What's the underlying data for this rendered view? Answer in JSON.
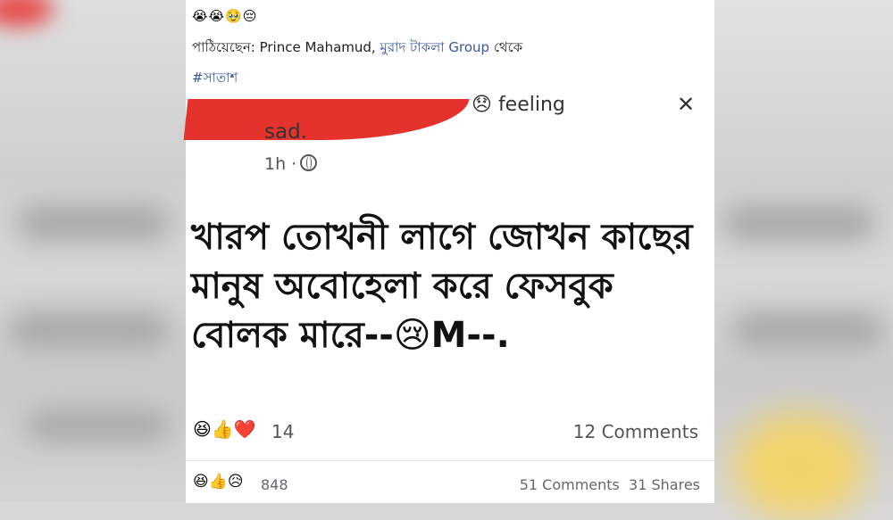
{
  "header": {
    "emojis": "😭😭🥹😔",
    "sent_prefix": "পাঠিয়েছেন: Prince Mahamud, ",
    "sent_group": "মুরাদ টাকলা Group",
    "sent_suffix": " থেকে",
    "hashtag": "#সাতাশ"
  },
  "screenshot": {
    "feeling_text": "feeling",
    "feeling_emoji": "😞",
    "close_glyph": "✕",
    "status_word": "sad.",
    "time": "1h ·",
    "post_text": "খারপ তোখনী লাগে জোখন কাছের মানুষ অবোহেলা করে ফেসবুক বোলক মারে--",
    "post_emoji": "😢",
    "post_suffix": "M--.",
    "reaction_icons": "😆👍❤️",
    "reaction_count": "14",
    "comments": "12 Comments"
  },
  "footer": {
    "reaction_icons": "😆👍😥",
    "reaction_count": "848",
    "comments": "51 Comments",
    "shares": "31 Shares"
  },
  "colors": {
    "link": "#385898",
    "redaction": "#e5322d",
    "background": "#d7d7d7"
  }
}
